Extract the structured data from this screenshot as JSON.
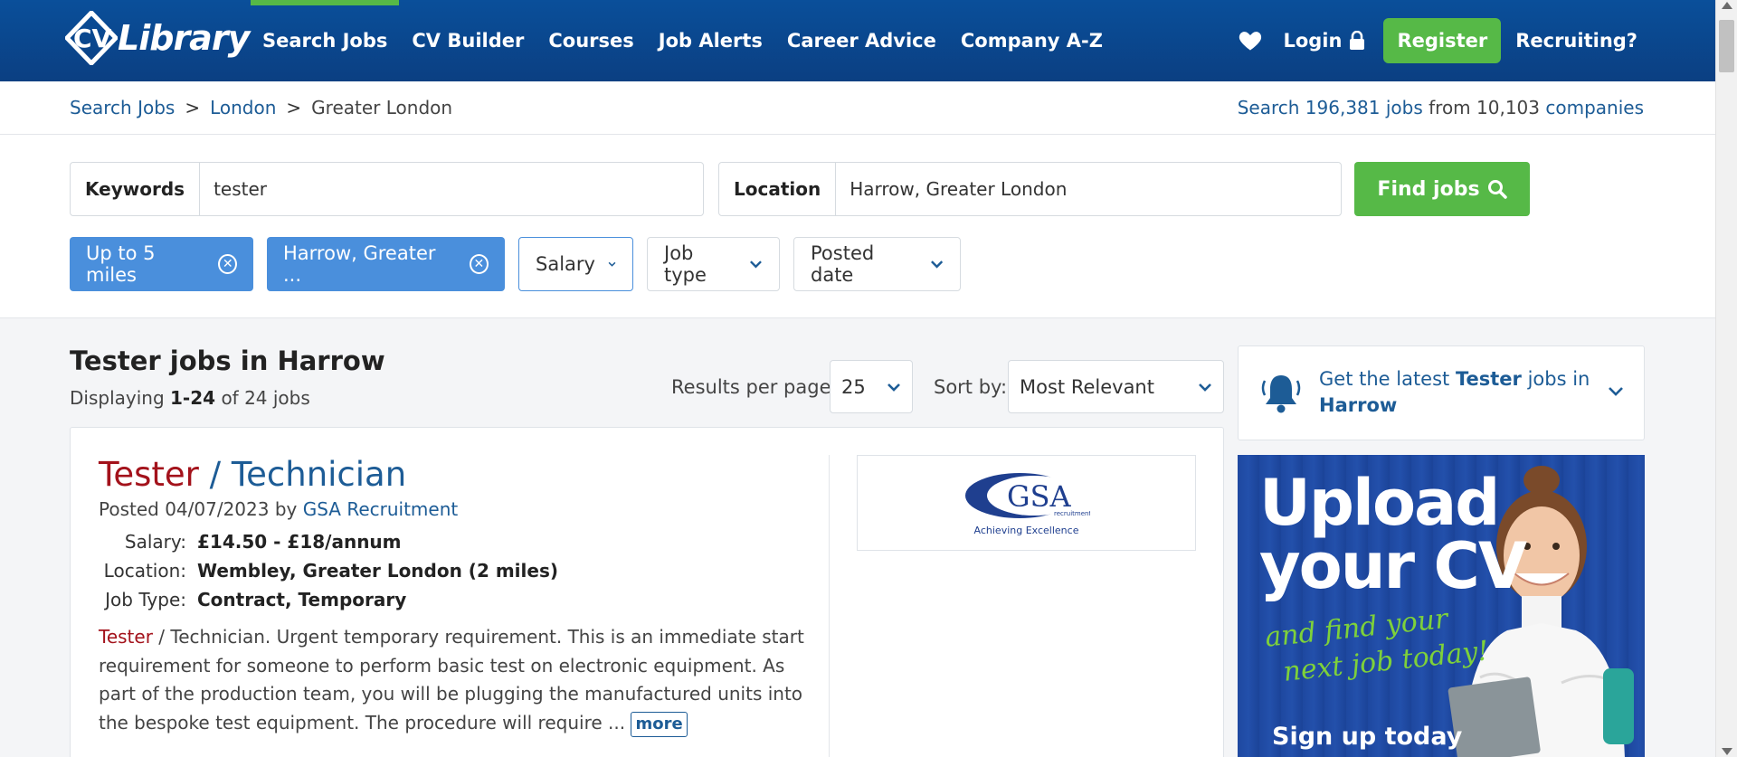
{
  "brand": {
    "name": "CV-Library",
    "logo_text": "Library"
  },
  "nav": {
    "items": [
      {
        "label": "Search Jobs",
        "active": true
      },
      {
        "label": "CV Builder"
      },
      {
        "label": "Courses"
      },
      {
        "label": "Job Alerts"
      },
      {
        "label": "Career Advice"
      },
      {
        "label": "Company A-Z"
      }
    ],
    "login": "Login",
    "register": "Register",
    "recruiting": "Recruiting?"
  },
  "breadcrumb": {
    "items": [
      "Search Jobs",
      "London",
      "Greater London"
    ],
    "separator": ">"
  },
  "stats": {
    "prefix": "Search",
    "jobs": "196,381 jobs",
    "mid": "from 10,103",
    "companies": "companies"
  },
  "search": {
    "keywords_label": "Keywords",
    "keywords_value": "tester",
    "location_label": "Location",
    "location_value": "Harrow, Greater London",
    "find_label": "Find jobs"
  },
  "filters": {
    "distance": "Up to 5 miles",
    "location": "Harrow, Greater ...",
    "salary": "Salary",
    "job_type": "Job type",
    "posted_date": "Posted date"
  },
  "results": {
    "title": "Tester jobs in Harrow",
    "count_prefix": "Displaying",
    "count_range": "1-24",
    "count_suffix": "of 24 jobs",
    "rpp_label": "Results per page:",
    "rpp_value": "25",
    "sort_label": "Sort by:",
    "sort_value": "Most Relevant"
  },
  "alert": {
    "prefix": "Get the latest",
    "keyword": "Tester",
    "mid": "jobs in",
    "location": "Harrow"
  },
  "ad": {
    "line1": "Upload",
    "line2": "your CV",
    "tagline1": "and find your",
    "tagline2": "next job today!",
    "cta": "Sign up today"
  },
  "job": {
    "title_highlight": "Tester",
    "title_rest": " / Technician",
    "posted_prefix": "Posted 04/07/2023 by",
    "company": "GSA Recruitment",
    "salary_label": "Salary:",
    "salary": "£14.50 - £18/annum",
    "location_label": "Location:",
    "location": "Wembley, Greater London (2 miles)",
    "type_label": "Job Type:",
    "type": "Contract, Temporary",
    "desc_highlight": "Tester",
    "desc_rest": " / Technician. Urgent temporary requirement. This is an immediate start requirement for someone to perform basic test on electronic equipment. As part of the production team, you will be plugging the manufactured units into the bespoke test equipment. The procedure will require ...",
    "more": "more",
    "logo_name": "GSA",
    "logo_sub": "recruitment",
    "logo_tagline": "Achieving Excellence"
  },
  "colors": {
    "nav_bg": "#0b4a94",
    "accent_green": "#56b947",
    "chip_blue": "#4a8fdc",
    "link_blue": "#1d5c96",
    "highlight_red": "#a3121b"
  }
}
